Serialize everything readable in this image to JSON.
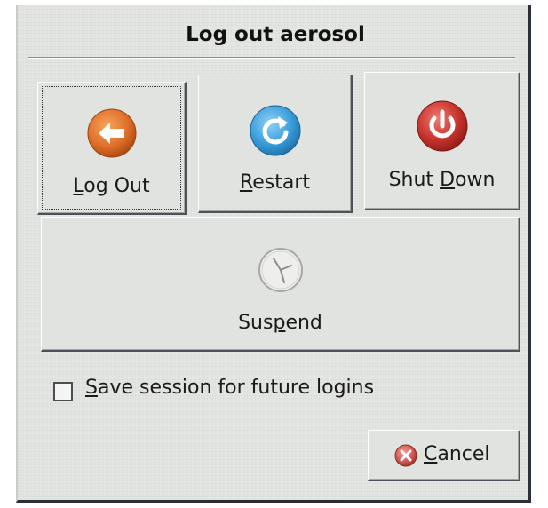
{
  "dialog": {
    "title": "Log out aerosol"
  },
  "buttons": {
    "logout": {
      "prefix": "",
      "mnemonic": "L",
      "rest": "og Out",
      "icon": "logout-arrow-icon",
      "color": "#e0702a"
    },
    "restart": {
      "prefix": "",
      "mnemonic": "R",
      "rest": "estart",
      "icon": "restart-icon",
      "color": "#3a9fdc"
    },
    "shutdown": {
      "prefix": "Shut ",
      "mnemonic": "D",
      "rest": "own",
      "icon": "power-icon",
      "color": "#c8342c"
    },
    "suspend": {
      "prefix": "Sus",
      "mnemonic": "p",
      "rest": "end",
      "icon": "clock-icon"
    },
    "cancel": {
      "prefix": "",
      "mnemonic": "C",
      "rest": "ancel",
      "icon": "cancel-icon",
      "color": "#d35a56"
    }
  },
  "save_session": {
    "mnemonic": "S",
    "rest": "ave session for future logins",
    "checked": false
  }
}
